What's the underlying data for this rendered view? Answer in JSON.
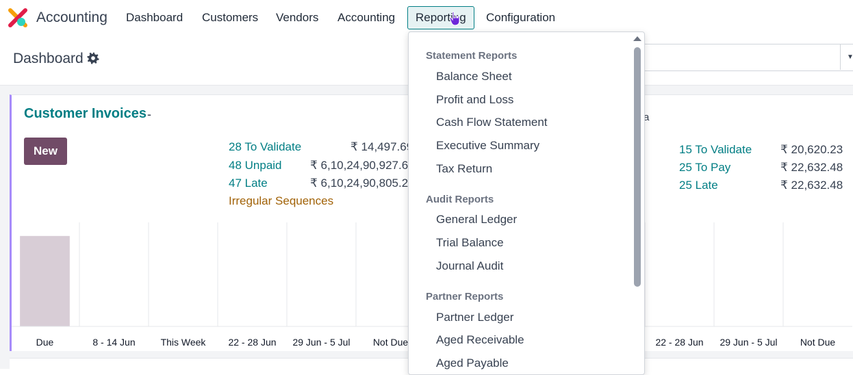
{
  "app": {
    "name": "Accounting",
    "logo_icon": "odoo-accounting-logo-icon"
  },
  "nav": {
    "items": [
      {
        "label": "Dashboard"
      },
      {
        "label": "Customers"
      },
      {
        "label": "Vendors"
      },
      {
        "label": "Accounting"
      },
      {
        "label": "Reporting"
      },
      {
        "label": "Configuration"
      }
    ],
    "active": "Reporting"
  },
  "page": {
    "title": "Dashboard",
    "settings_icon": "gear-icon"
  },
  "customer_invoices": {
    "title": "Customer Invoices",
    "title_suffix": "-",
    "new_label": "New",
    "stats": [
      {
        "label": "28 To Validate",
        "amount": "₹ 14,497.69"
      },
      {
        "label": "48 Unpaid",
        "amount": "₹ 6,10,24,90,927.62"
      },
      {
        "label": "47 Late",
        "amount": "₹ 6,10,24,90,805.22"
      }
    ],
    "irregular_label": "Irregular Sequences"
  },
  "vendor_bills": {
    "title_fragment": "a",
    "stats": [
      {
        "label": "15 To Validate",
        "amount": "₹ 20,620.23"
      },
      {
        "label": "25 To Pay",
        "amount": "₹ 22,632.48"
      },
      {
        "label": "25 Late",
        "amount": "₹ 22,632.48"
      }
    ]
  },
  "chart_data": [
    {
      "type": "bar",
      "categories": [
        "Due",
        "8 - 14 Jun",
        "This Week",
        "22 - 28 Jun",
        "29 Jun - 5 Jul",
        "Not Due"
      ],
      "values": [
        1,
        0,
        0,
        0,
        0,
        0
      ],
      "ylim": [
        0,
        1.15
      ],
      "bar_color": "#d8cdd6",
      "grid": true
    },
    {
      "type": "bar",
      "categories": [
        "22 - 28 Jun",
        "29 Jun - 5 Jul",
        "Not Due"
      ],
      "values": [
        0,
        0,
        0
      ],
      "ylim": [
        0,
        1.15
      ],
      "grid": true
    }
  ],
  "reporting_menu": {
    "sections": [
      {
        "header": "Statement Reports",
        "items": [
          "Balance Sheet",
          "Profit and Loss",
          "Cash Flow Statement",
          "Executive Summary",
          "Tax Return"
        ]
      },
      {
        "header": "Audit Reports",
        "items": [
          "General Ledger",
          "Trial Balance",
          "Journal Audit"
        ]
      },
      {
        "header": "Partner Reports",
        "items": [
          "Partner Ledger",
          "Aged Receivable",
          "Aged Payable"
        ]
      }
    ]
  },
  "colors": {
    "brand_teal": "#017e84",
    "primary_button": "#714b67",
    "card_accent": "#a78bfa",
    "irregular": "#a16207"
  }
}
